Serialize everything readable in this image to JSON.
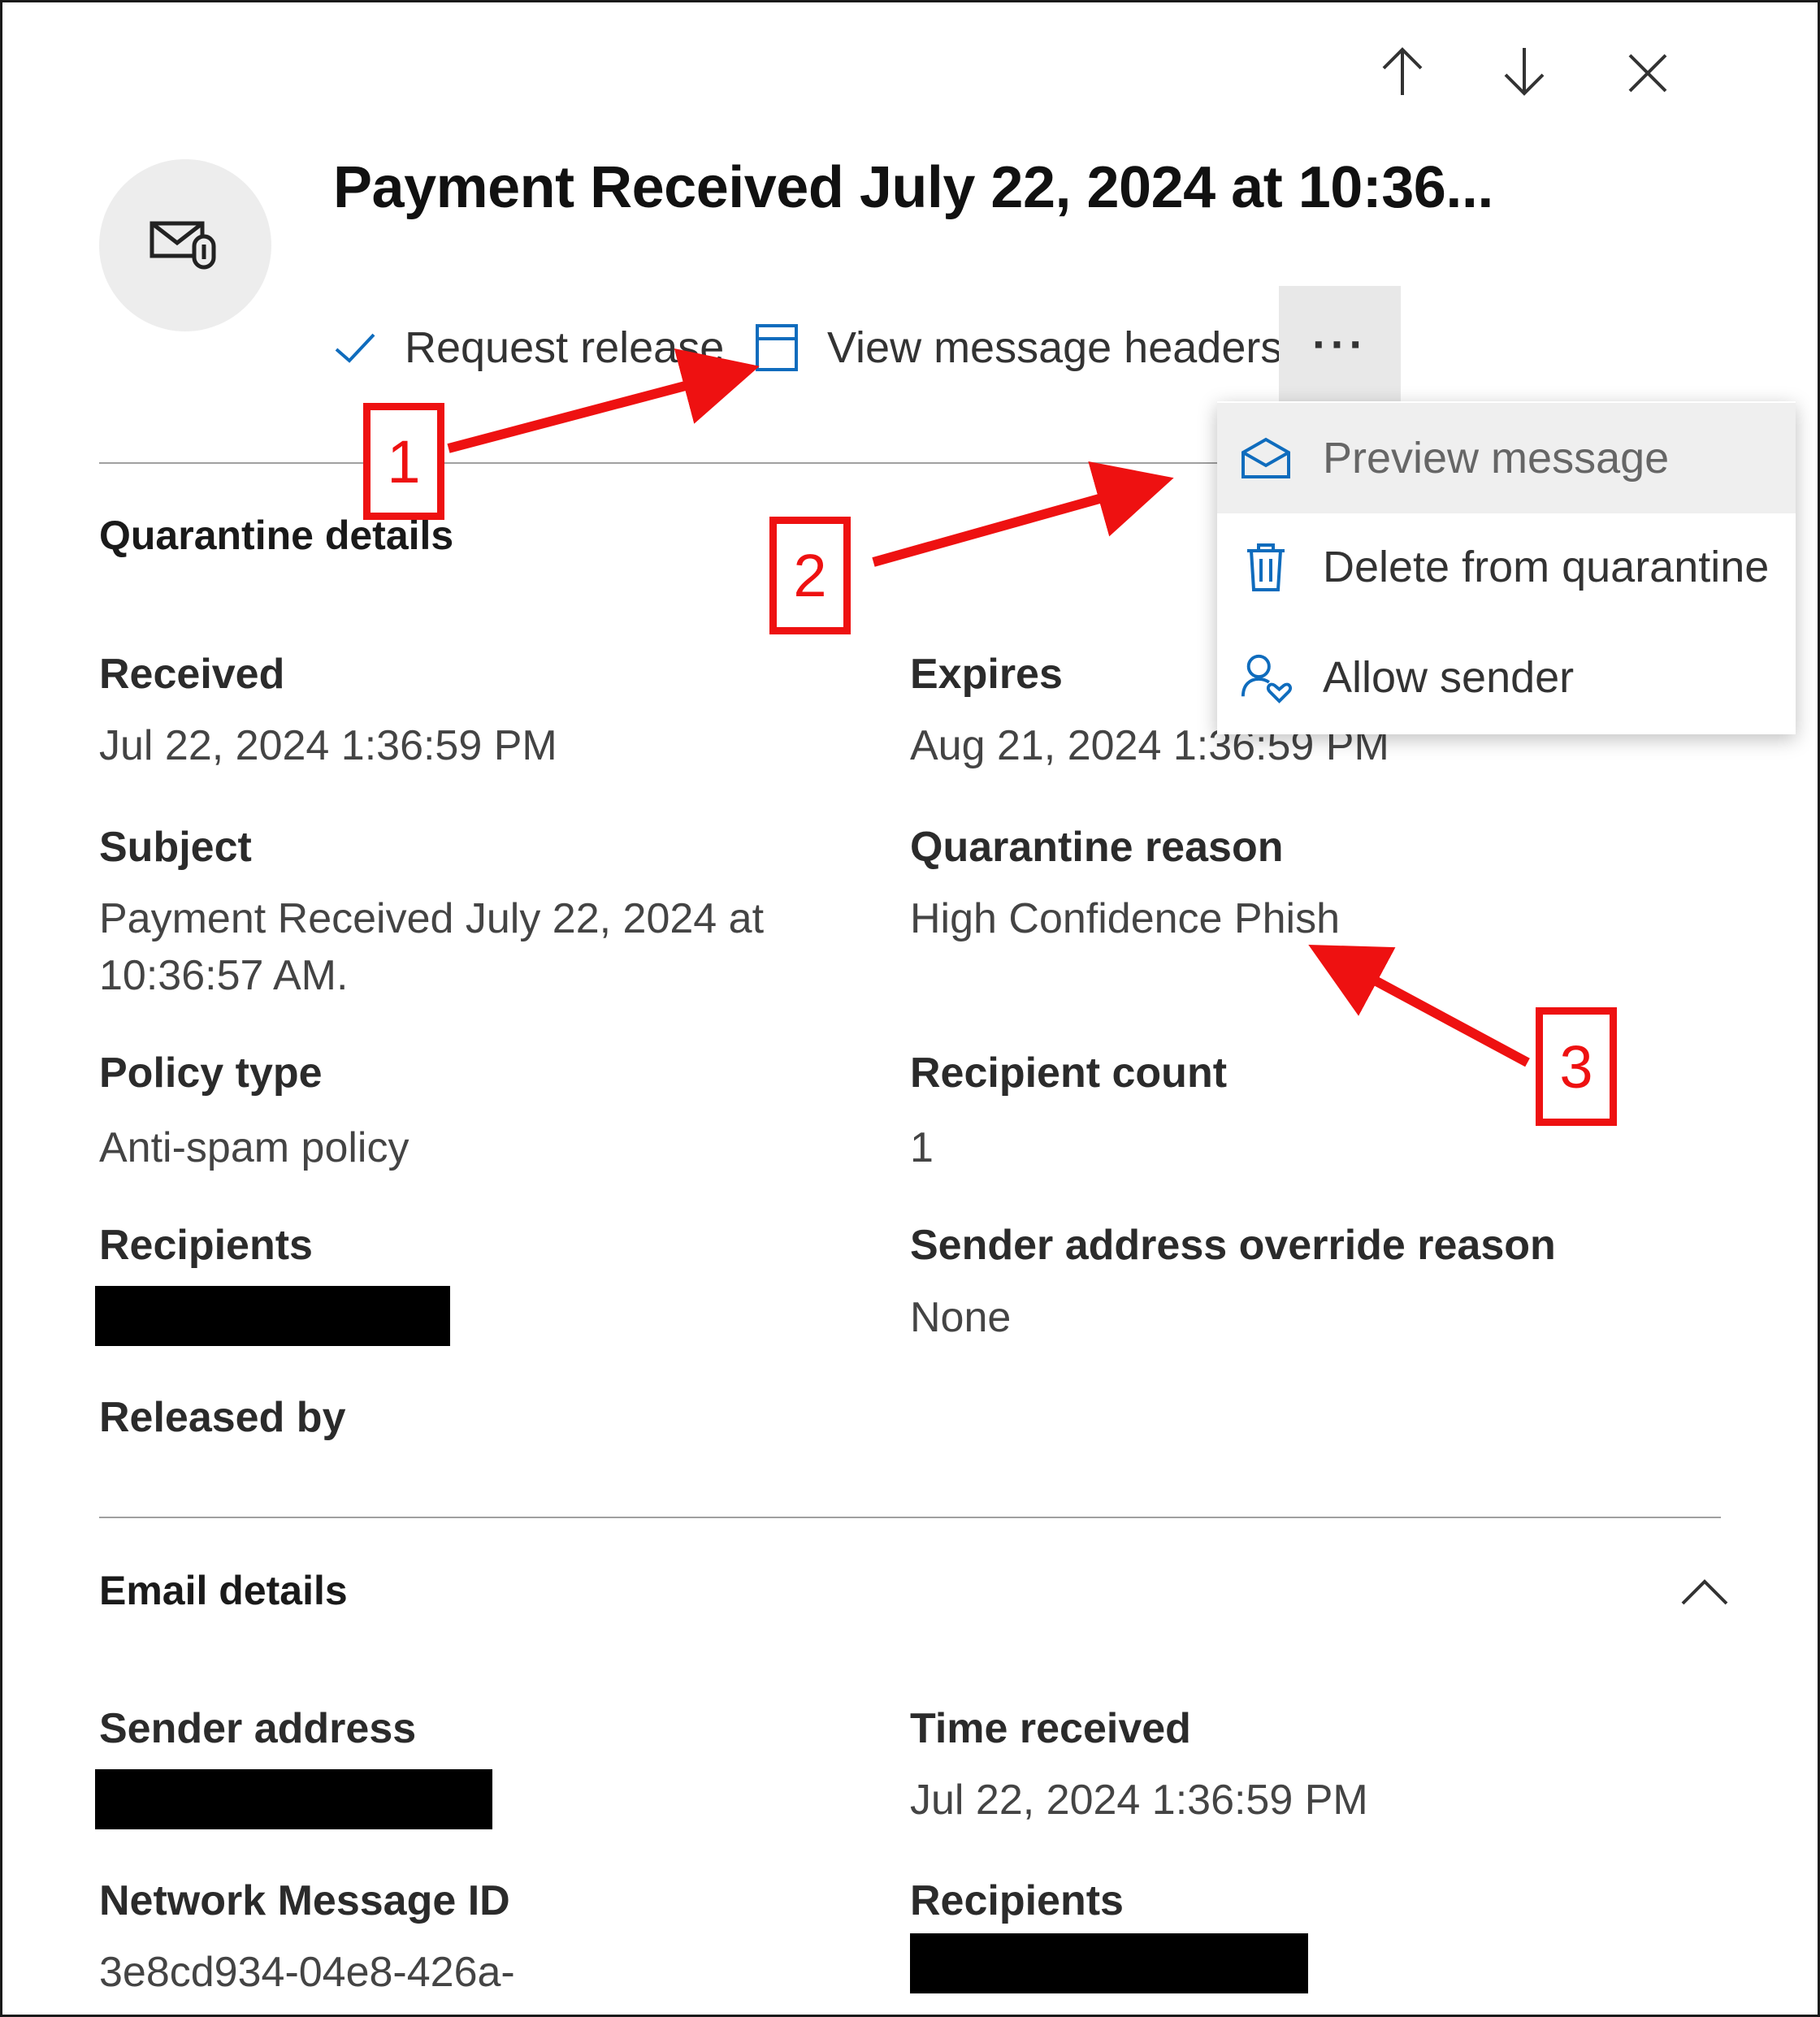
{
  "panel": {
    "title": "Payment Received July 22, 2024 at 10:36...",
    "nav": {
      "up_icon": "arrow-up-icon",
      "down_icon": "arrow-down-icon",
      "close_icon": "close-icon"
    },
    "avatar_icon": "mail-attachment-icon"
  },
  "commands": {
    "request_release": "Request release",
    "view_headers": "View message headers",
    "more": "···"
  },
  "menu": {
    "items": [
      {
        "label": "Preview message",
        "icon": "open-envelope-icon"
      },
      {
        "label": "Delete from quarantine",
        "icon": "trash-icon"
      },
      {
        "label": "Allow sender",
        "icon": "person-heart-icon"
      }
    ]
  },
  "quarantine": {
    "title": "Quarantine details",
    "received_label": "Received",
    "received": "Jul 22, 2024 1:36:59 PM",
    "expires_label": "Expires",
    "expires": "Aug 21, 2024 1:36:59 PM",
    "subject_label": "Subject",
    "subject_line1": "Payment Received July 22, 2024 at",
    "subject_line2": "10:36:57 AM.",
    "reason_label": "Quarantine reason",
    "reason": "High Confidence Phish",
    "policy_type_label": "Policy type",
    "policy_type": "Anti-spam policy",
    "recipient_count_label": "Recipient count",
    "recipient_count": "1",
    "recipients_label": "Recipients",
    "override_label": "Sender address override reason",
    "override": "None",
    "released_by_label": "Released by"
  },
  "email": {
    "title": "Email details",
    "sender_label": "Sender address",
    "time_received_label": "Time received",
    "time_received": "Jul 22, 2024 1:36:59 PM",
    "network_id_label": "Network Message ID",
    "network_id": "3e8cd934-04e8-426a-",
    "recipients_label": "Recipients"
  },
  "callouts": [
    "1",
    "2",
    "3"
  ],
  "colors": {
    "accent": "#0f6cbd",
    "callout": "#ee1111"
  }
}
